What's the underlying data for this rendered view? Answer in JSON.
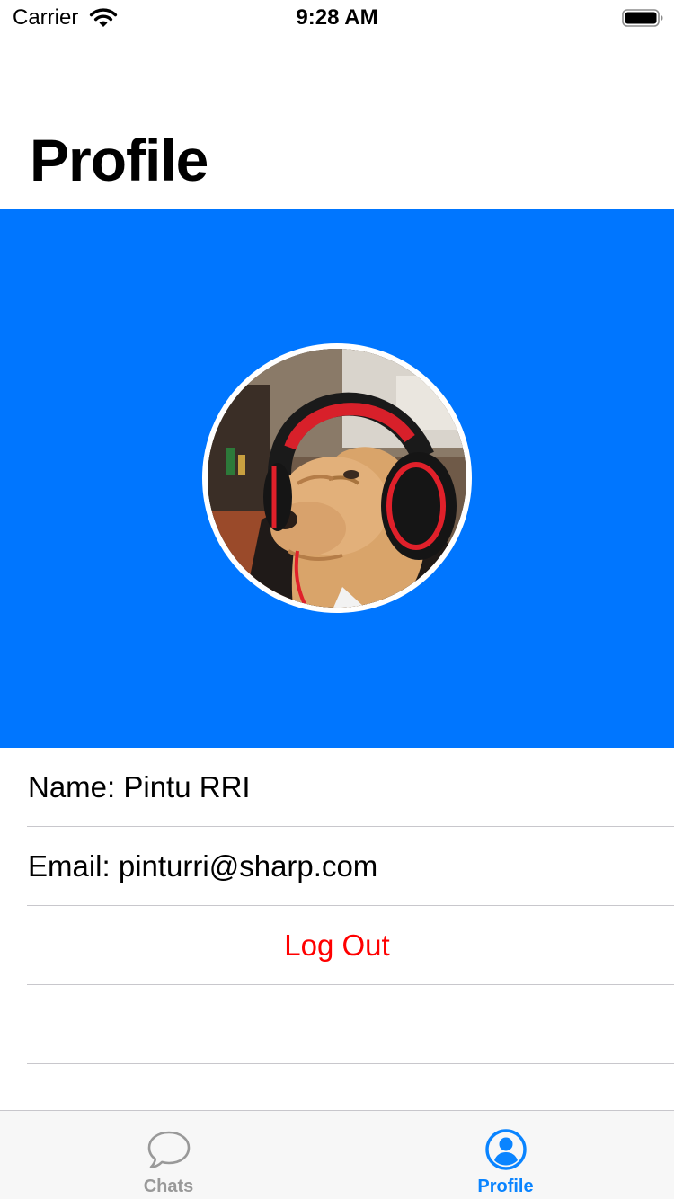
{
  "status_bar": {
    "carrier": "Carrier",
    "time": "9:28 AM",
    "wifi_icon": "wifi-icon",
    "battery_icon": "battery-full-icon"
  },
  "header": {
    "title": "Profile",
    "banner_color": "#0076ff",
    "avatar_icon": "profile-photo-dog-with-headphones"
  },
  "details": {
    "name": "Name: Pintu RRI",
    "email": "Email: pinturri@sharp.com",
    "logout_label": "Log Out",
    "logout_color": "#ff0000"
  },
  "tab_bar": {
    "tabs": [
      {
        "label": "Chats",
        "icon": "chat-bubble-icon",
        "selected": false
      },
      {
        "label": "Profile",
        "icon": "person-circle-icon",
        "selected": true
      }
    ],
    "active_color": "#0a84ff",
    "inactive_color": "#999999"
  }
}
